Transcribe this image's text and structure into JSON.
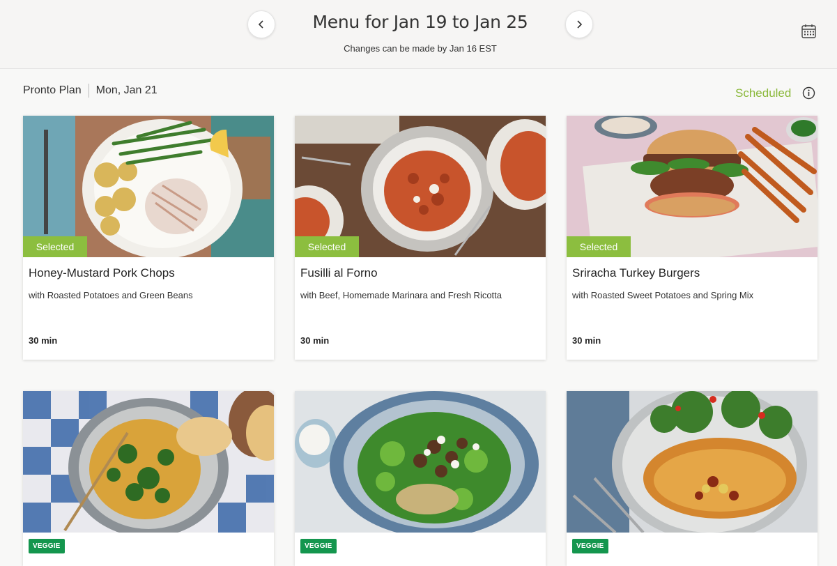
{
  "header": {
    "title": "Menu for Jan 19 to Jan 25",
    "subtitle": "Changes can be made by Jan 16 EST",
    "prev_icon": "chevron-left-icon",
    "next_icon": "chevron-right-icon",
    "calendar_icon": "calendar-icon"
  },
  "plan": {
    "name": "Pronto Plan",
    "date": "Mon, Jan 21",
    "status": "Scheduled",
    "status_color": "#8ab83a",
    "info_icon": "info-icon"
  },
  "colors": {
    "selected_badge": "#8cbe3f",
    "veggie_badge": "#14964e"
  },
  "recipes": [
    {
      "badge": "Selected",
      "title": "Honey-Mustard Pork Chops",
      "subtitle": "with Roasted Potatoes and Green Beans",
      "time": "30 min"
    },
    {
      "badge": "Selected",
      "title": "Fusilli al Forno",
      "subtitle": "with Beef, Homemade Marinara and Fresh Ricotta",
      "time": "30 min"
    },
    {
      "badge": "Selected",
      "title": "Sriracha Turkey Burgers",
      "subtitle": "with Roasted Sweet Potatoes and Spring Mix",
      "time": "30 min"
    },
    {
      "badge": "VEGGIE"
    },
    {
      "badge": "VEGGIE"
    },
    {
      "badge": "VEGGIE"
    }
  ]
}
